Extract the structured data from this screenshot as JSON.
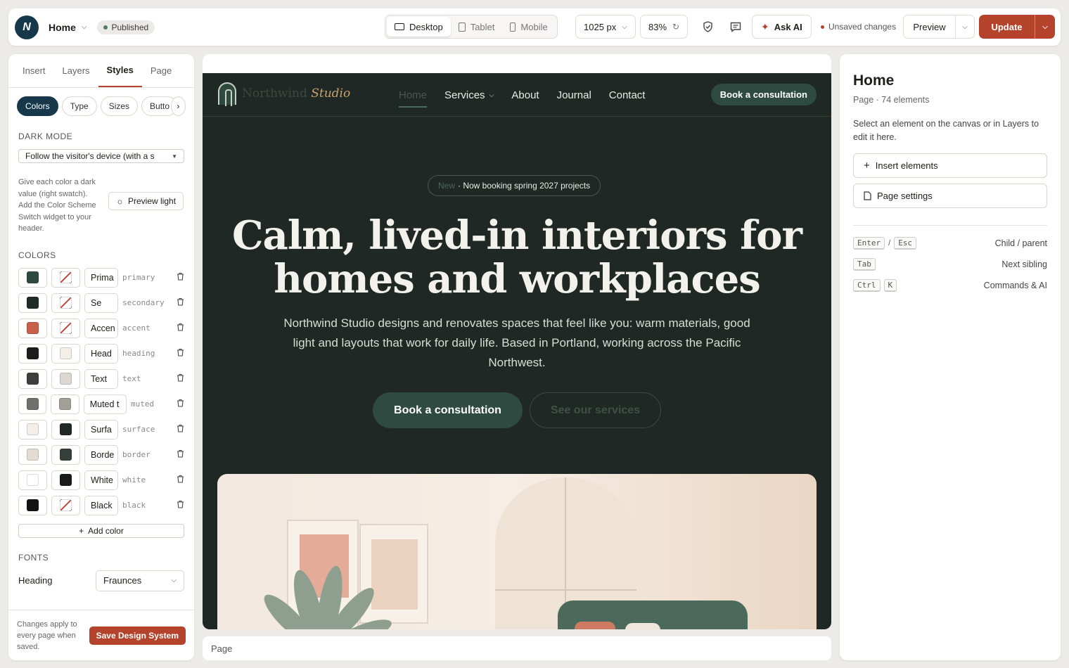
{
  "topbar": {
    "logo_letter": "N",
    "page_name": "Home",
    "status": "Published",
    "devices": [
      {
        "label": "Desktop",
        "active": true
      },
      {
        "label": "Tablet",
        "active": false
      },
      {
        "label": "Mobile",
        "active": false
      }
    ],
    "width_value": "1025 px",
    "zoom_value": "83%",
    "ask_ai": "Ask AI",
    "unsaved": "Unsaved changes",
    "preview": "Preview",
    "update": "Update"
  },
  "left": {
    "tabs": [
      "Insert",
      "Layers",
      "Styles",
      "Page"
    ],
    "active_tab": "Styles",
    "chips": [
      "Colors",
      "Type",
      "Sizes",
      "Butto"
    ],
    "dark_mode_label": "DARK MODE",
    "dark_mode_value": "Follow the visitor's device (with a s",
    "dark_mode_help": "Give each color a dark value (right swatch). Add the Color Scheme Switch widget to your header.",
    "preview_light": "Preview light",
    "colors_label": "COLORS",
    "colors": [
      {
        "name": "Prima",
        "token": "primary",
        "light": "#2e4a40",
        "dark": "none"
      },
      {
        "name": "Se",
        "token": "secondary",
        "light": "#1f2b27",
        "dark": "none"
      },
      {
        "name": "Accen",
        "token": "accent",
        "light": "#c9604a",
        "dark": "none"
      },
      {
        "name": "Head",
        "token": "heading",
        "light": "#1b1d1b",
        "dark": "#f3eee6"
      },
      {
        "name": "Text",
        "token": "text",
        "light": "#3c3f3c",
        "dark": "#dcd7d1"
      },
      {
        "name": "Muted t",
        "token": "muted",
        "light": "#6f706c",
        "dark": "#a29f99"
      },
      {
        "name": "Surfa",
        "token": "surface",
        "light": "#f3eee7",
        "dark": "#1f2824"
      },
      {
        "name": "Borde",
        "token": "border",
        "light": "#e4dcd3",
        "dark": "#36403b"
      },
      {
        "name": "White",
        "token": "white",
        "light": "#ffffff",
        "dark": "#181b19"
      },
      {
        "name": "Black",
        "token": "black",
        "light": "#121212",
        "dark": "none"
      }
    ],
    "add_color": "Add color",
    "fonts_label": "FONTS",
    "font_heading_label": "Heading",
    "font_heading_value": "Fraunces",
    "footer_note": "Changes apply to every page when saved.",
    "save_button": "Save Design System"
  },
  "site": {
    "brand_plain": "Northwind",
    "brand_italic": "Studio",
    "nav": [
      {
        "label": "Home",
        "current": true,
        "has_menu": false
      },
      {
        "label": "Services",
        "current": false,
        "has_menu": true
      },
      {
        "label": "About",
        "current": false,
        "has_menu": false
      },
      {
        "label": "Journal",
        "current": false,
        "has_menu": false
      },
      {
        "label": "Contact",
        "current": false,
        "has_menu": false
      }
    ],
    "nav_cta": "Book a consultation",
    "news_tag": "New",
    "news_text": "· Now booking spring 2027 projects",
    "hero_title": "Calm, lived-in interiors for homes and workplaces",
    "hero_sub": "Northwind Studio designs and renovates spaces that feel like you: warm materials, good light and layouts that work for daily life. Based in Portland, working across the Pacific Northwest.",
    "hero_cta_primary": "Book a consultation",
    "hero_cta_secondary": "See our services"
  },
  "canvas_footer": "Page",
  "right": {
    "title": "Home",
    "meta": "Page · 74 elements",
    "help": "Select an element on the canvas or in Layers to edit it here.",
    "insert_btn": "Insert elements",
    "settings_btn": "Page settings",
    "shortcuts": [
      {
        "keys": [
          "Enter",
          "/",
          "Esc"
        ],
        "action": "Child / parent"
      },
      {
        "keys": [
          "Tab"
        ],
        "action": "Next sibling"
      },
      {
        "keys": [
          "Ctrl",
          "K"
        ],
        "action": "Commands & AI"
      }
    ]
  }
}
